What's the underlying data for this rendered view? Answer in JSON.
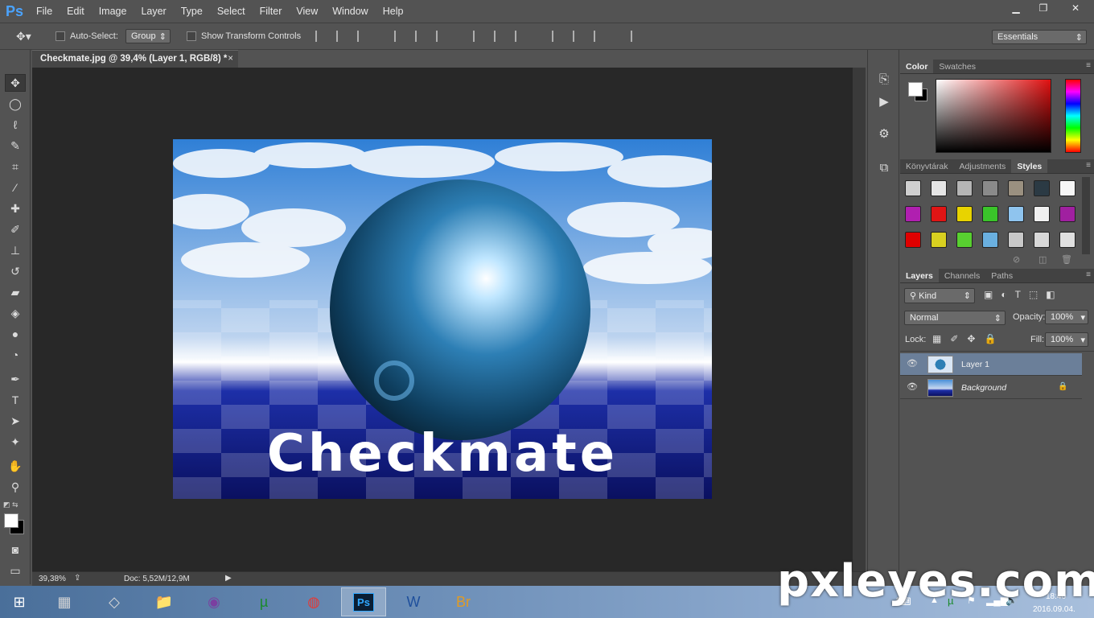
{
  "app": {
    "logo": "Ps"
  },
  "menu": [
    "File",
    "Edit",
    "Image",
    "Layer",
    "Type",
    "Select",
    "Filter",
    "View",
    "Window",
    "Help"
  ],
  "window_controls": {
    "minimize": "▁",
    "restore": "❐",
    "close": "✕"
  },
  "options": {
    "auto_select_label": "Auto-Select:",
    "auto_select_value": "Group",
    "show_transform_label": "Show Transform Controls",
    "workspace": "Essentials"
  },
  "document": {
    "tab_title": "Checkmate.jpg @ 39,4% (Layer 1, RGB/8) *",
    "canvas_text": "Checkmate",
    "zoom": "39,38%",
    "doc_size": "Doc: 5,52M/12,9M"
  },
  "color_panel": {
    "tabs": [
      "Color",
      "Swatches"
    ],
    "active": "Color"
  },
  "styles_panel": {
    "tabs": [
      "Könyvtárak",
      "Adjustments",
      "Styles"
    ],
    "active": "Styles"
  },
  "layers_panel": {
    "tabs": [
      "Layers",
      "Channels",
      "Paths"
    ],
    "active": "Layers",
    "filter": "Kind",
    "blend_mode": "Normal",
    "opacity_label": "Opacity:",
    "opacity": "100%",
    "lock_label": "Lock:",
    "fill_label": "Fill:",
    "fill": "100%",
    "layers": [
      {
        "name": "Layer 1",
        "selected": true
      },
      {
        "name": "Background",
        "locked": true
      }
    ]
  },
  "taskbar": {
    "time": "18:46",
    "date": "2016.09.04."
  },
  "watermark": "pxleyes.com",
  "colors": {
    "accent": "#4aa3ff",
    "selected_layer": "#6b7f99",
    "ps_blue": "#31a8ff"
  }
}
